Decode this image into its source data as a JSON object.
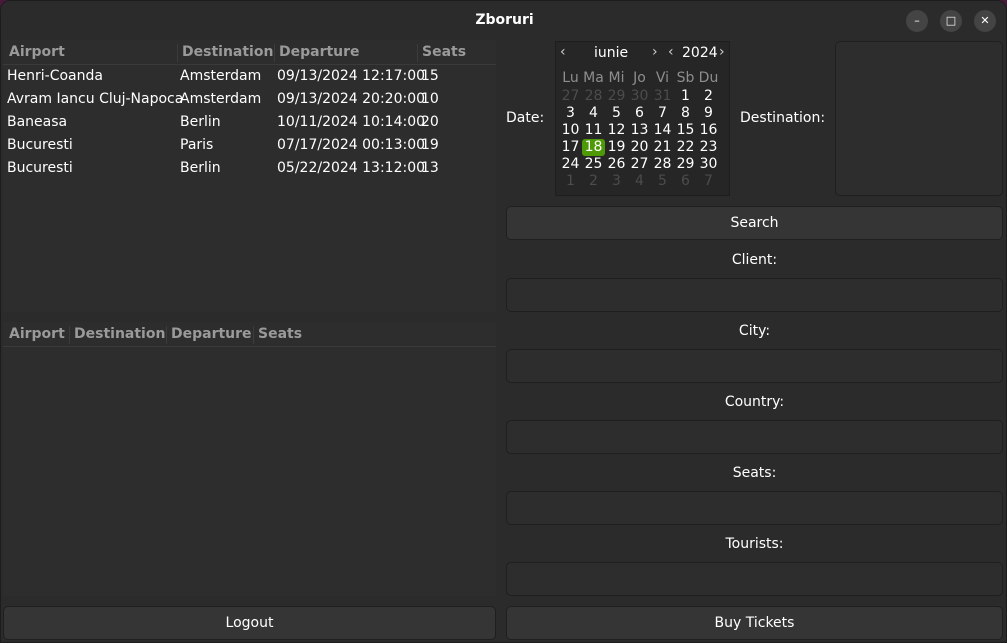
{
  "window": {
    "title": "Zboruri"
  },
  "flights_table": {
    "columns": [
      "Airport",
      "Destination",
      "Departure",
      "Seats"
    ],
    "rows": [
      {
        "airport": "Henri-Coanda",
        "destination": "Amsterdam",
        "departure": "09/13/2024 12:17:00",
        "seats": "15"
      },
      {
        "airport": "Avram Iancu Cluj-Napoca",
        "destination": "Amsterdam",
        "departure": "09/13/2024 20:20:00",
        "seats": "10"
      },
      {
        "airport": "Baneasa",
        "destination": "Berlin",
        "departure": "10/11/2024 10:14:00",
        "seats": "20"
      },
      {
        "airport": "Bucuresti",
        "destination": "Paris",
        "departure": "07/17/2024 00:13:00",
        "seats": "19"
      },
      {
        "airport": "Bucuresti",
        "destination": "Berlin",
        "departure": "05/22/2024 13:12:00",
        "seats": "13"
      }
    ]
  },
  "results_table": {
    "columns": [
      "Airport",
      "Destination",
      "Departure",
      "Seats"
    ],
    "rows": []
  },
  "search": {
    "date_label": "Date:",
    "destination_label": "Destination:",
    "destination_value": "",
    "search_button": "Search"
  },
  "calendar": {
    "month": "iunie",
    "year": "2024",
    "weekdays": [
      "Lu",
      "Ma",
      "Mi",
      "Jo",
      "Vi",
      "Sb",
      "Du"
    ],
    "weeks": [
      [
        "27",
        "28",
        "29",
        "30",
        "31",
        "1",
        "2"
      ],
      [
        "3",
        "4",
        "5",
        "6",
        "7",
        "8",
        "9"
      ],
      [
        "10",
        "11",
        "12",
        "13",
        "14",
        "15",
        "16"
      ],
      [
        "17",
        "18",
        "19",
        "20",
        "21",
        "22",
        "23"
      ],
      [
        "24",
        "25",
        "26",
        "27",
        "28",
        "29",
        "30"
      ],
      [
        "1",
        "2",
        "3",
        "4",
        "5",
        "6",
        "7"
      ]
    ],
    "selected_day": "18",
    "selected_color": "#4e9a06"
  },
  "form": {
    "client_label": "Client:",
    "city_label": "City:",
    "country_label": "Country:",
    "seats_label": "Seats:",
    "tourists_label": "Tourists:",
    "client_value": "",
    "city_value": "",
    "country_value": "",
    "seats_value": "",
    "tourists_value": ""
  },
  "buttons": {
    "logout": "Logout",
    "buy_tickets": "Buy Tickets"
  },
  "icons": {
    "minimize": "minimize-icon",
    "maximize": "maximize-icon",
    "close": "close-icon"
  }
}
